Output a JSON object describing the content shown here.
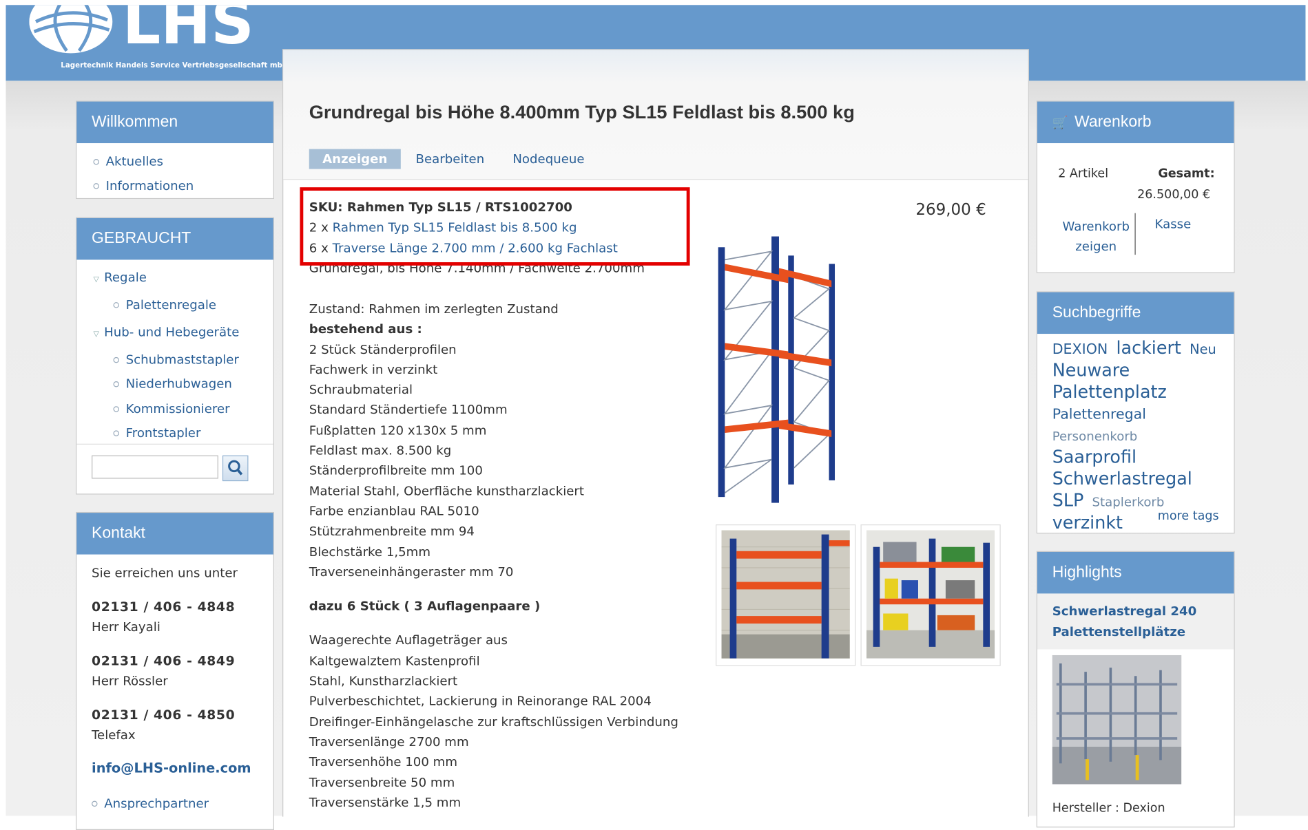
{
  "brand": {
    "logo_letters": "LHS",
    "tagline": "Lagertechnik Handels Service Vertriebsgesellschaft mbH"
  },
  "colors": {
    "header_blue": "#6699cc",
    "link": "#2a5f96",
    "highlight_frame": "#e30000",
    "rack_blue": "#1e3c8c",
    "rack_orange": "#e8501e"
  },
  "left": {
    "welcome": {
      "title": "Willkommen",
      "items": [
        "Aktuelles",
        "Informationen"
      ]
    },
    "used": {
      "title": "GEBRAUCHT",
      "groups": [
        {
          "label": "Regale",
          "children": [
            "Palettenregale"
          ]
        },
        {
          "label": "Hub- und Hebegeräte",
          "children": [
            "Schubmaststapler",
            "Niederhubwagen",
            "Kommissionierer",
            "Frontstapler"
          ]
        }
      ],
      "search_icon": "magnifier-icon"
    },
    "contact": {
      "title": "Kontakt",
      "intro": "Sie erreichen uns unter",
      "entries": [
        {
          "phone": "02131 / 406 - 4848",
          "name": "Herr Kayali"
        },
        {
          "phone": "02131 / 406 - 4849",
          "name": "Herr Rössler"
        },
        {
          "phone": "02131 / 406 - 4850",
          "name": "Telefax"
        }
      ],
      "email": "info@LHS-online.com",
      "partner_link": "Ansprechpartner"
    }
  },
  "main": {
    "title": "Grundregal bis Höhe 8.400mm Typ SL15 Feldlast bis 8.500 kg",
    "tabs": [
      "Anzeigen",
      "Bearbeiten",
      "Nodequeue"
    ],
    "sku": "SKU: Rahmen Typ SL15 / RTS1002700",
    "components": [
      {
        "qty": "2 x",
        "label": "Rahmen Typ SL15 Feldlast bis 8.500 kg"
      },
      {
        "qty": "6 x",
        "label": "Traverse Länge 2.700 mm / 2.600 kg Fachlast"
      }
    ],
    "price": "269,00 €",
    "intro_line": "Grundregal, bis Höhe 7.140mm / Fachweite 2.700mm",
    "condition": "Zustand: Rahmen im zerlegten Zustand",
    "consists_label": "bestehend aus :",
    "consists_items": [
      "2 Stück Ständerprofilen",
      "Fachwerk in verzinkt",
      "Schraubmaterial",
      "Standard Ständertiefe 1100mm",
      "Fußplatten 120 x130x 5 mm",
      "Feldlast max. 8.500 kg",
      "Ständerprofilbreite mm 100",
      "Material Stahl, Oberfläche kunstharzlackiert",
      "Farbe enzianblau RAL 5010",
      "Stützrahmenbreite mm 94",
      "Blechstärke 1,5mm",
      "Traverseneinhängeraster mm 70"
    ],
    "extra_heading": "dazu 6 Stück ( 3 Auflagenpaare )",
    "extra_items": [
      "Waagerechte Auflageträger aus",
      "Kaltgewalztem Kastenprofil",
      "Stahl, Kunstharzlackiert",
      "Pulverbeschichtet, Lackierung in Reinorange RAL 2004",
      "Dreifinger-Einhängelasche zur kraftschlüssigen Verbindung",
      "Traversenlänge 2700 mm",
      "Traversenhöhe 100 mm",
      "Traversenbreite 50 mm",
      "Traversenstärke 1,5 mm"
    ]
  },
  "right": {
    "cart": {
      "title": "Warenkorb",
      "icon": "cart-icon",
      "count": "2 Artikel",
      "total_label": "Gesamt:",
      "total_value": "26.500,00 €",
      "show_link_1": "Warenkorb",
      "show_link_2": "zeigen",
      "checkout_link": "Kasse"
    },
    "tags": {
      "title": "Suchbegriffe",
      "items": [
        {
          "t": "DEXION",
          "s": 17
        },
        {
          "t": "lackiert",
          "s": 21
        },
        {
          "t": "Neu",
          "s": 16
        },
        {
          "t": "Neuware",
          "s": 21
        },
        {
          "t": "Palettenplatz",
          "s": 21
        },
        {
          "t": "Palettenregal",
          "s": 17
        },
        {
          "t": "Personenkorb",
          "s": 15
        },
        {
          "t": "Saarprofil",
          "s": 21
        },
        {
          "t": "Schwerlastregal SLP",
          "s": 21
        },
        {
          "t": "Staplerkorb",
          "s": 15
        },
        {
          "t": "verzinkt",
          "s": 21
        }
      ],
      "more": "more tags"
    },
    "highlights": {
      "title": "Highlights",
      "product_title": "Schwerlastregal 240 Palettenstellplätze",
      "manufacturer": "Hersteller : Dexion"
    }
  }
}
